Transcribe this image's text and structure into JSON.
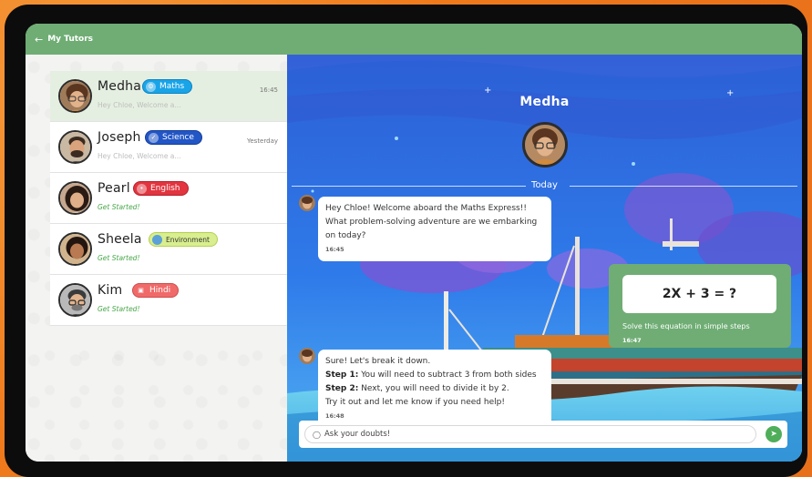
{
  "header": {
    "back_icon": "arrow-left-icon",
    "title": "My Tutors"
  },
  "tutors": [
    {
      "name": "Medha",
      "subject": "Maths",
      "subject_icon": "maths-icon",
      "subject_color": "#1aa4e8",
      "preview": "Hey Chloe, Welcome a...",
      "time": "16:45",
      "active": true,
      "started": false
    },
    {
      "name": "Joseph",
      "subject": "Science",
      "subject_icon": "science-icon",
      "subject_color": "#2256c6",
      "preview": "Hey Chloe, Welcome a...",
      "time": "Yesterday",
      "active": false,
      "started": false
    },
    {
      "name": "Pearl",
      "subject": "English",
      "subject_icon": "english-icon",
      "subject_color": "#e2353f",
      "preview": "Get Started!",
      "time": "",
      "active": false,
      "started": true
    },
    {
      "name": "Sheela",
      "subject": "Environment",
      "subject_icon": "environment-icon",
      "subject_color": "#d8ee8f",
      "preview": "Get Started!",
      "time": "",
      "active": false,
      "started": true
    },
    {
      "name": "Kim",
      "subject": "Hindi",
      "subject_icon": "hindi-icon",
      "subject_color": "#f06a6a",
      "preview": "Get Started!",
      "time": "",
      "active": false,
      "started": true
    }
  ],
  "chat": {
    "tutor_name": "Medha",
    "date_divider": "Today",
    "messages": [
      {
        "text": "Hey Chloe! Welcome aboard the Maths Express!! What problem-solving adventure are we embarking on today?",
        "time": "16:45"
      },
      {
        "intro": "Sure! Let's break it down.",
        "step1_label": "Step 1:",
        "step1": " You will need to subtract 3 from both sides",
        "step2_label": "Step 2:",
        "step2": " Next, you will need to divide it by 2.",
        "outro": "Try it out and let me know if you need help!",
        "time": "16:48"
      }
    ],
    "question": {
      "equation": "2X + 3 = ?",
      "caption": "Solve this equation in simple steps",
      "time": "16:47"
    },
    "input": {
      "placeholder": "Ask your doubts!",
      "camera_icon": "camera-icon",
      "send_icon": "send-icon"
    }
  },
  "colors": {
    "header": "#6fad74",
    "accent_green": "#4fae5a",
    "frame": "#f07c1f",
    "sky": "#2a6fe6"
  }
}
